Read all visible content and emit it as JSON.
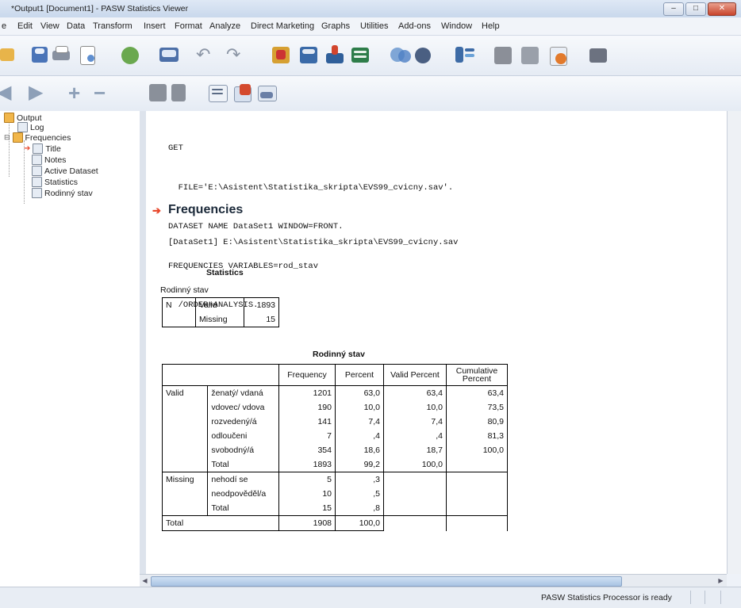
{
  "window": {
    "title": "*Output1 [Document1] - PASW Statistics Viewer"
  },
  "menu": [
    "e",
    "Edit",
    "View",
    "Data",
    "Transform",
    "Insert",
    "Format",
    "Analyze",
    "Direct Marketing",
    "Graphs",
    "Utilities",
    "Add-ons",
    "Window",
    "Help"
  ],
  "nav": {
    "output": "Output",
    "log": "Log",
    "frequencies": "Frequencies",
    "title": "Title",
    "notes": "Notes",
    "active_dataset": "Active Dataset",
    "statistics": "Statistics",
    "rodinny_stav": "Rodinný stav"
  },
  "syntax": [
    "GET",
    "  FILE='E:\\Asistent\\Statistika_skripta\\EVS99_cvicny.sav'.",
    "DATASET NAME DataSet1 WINDOW=FRONT.",
    "FREQUENCIES VARIABLES=rod_stav",
    "  /ORDER=ANALYSIS."
  ],
  "frequencies_title": "Frequencies",
  "dataset_line": "[DataSet1] E:\\Asistent\\Statistika_skripta\\EVS99_cvicny.sav",
  "statistics": {
    "caption": "Statistics",
    "variable": "Rodinný stav",
    "n": "N",
    "valid_label": "Valid",
    "valid_value": "1893",
    "missing_label": "Missing",
    "missing_value": "15"
  },
  "freq_table": {
    "caption": "Rodinný stav",
    "headers": {
      "frequency": "Frequency",
      "percent": "Percent",
      "valid_percent": "Valid Percent",
      "cumulative_1": "Cumulative",
      "cumulative_2": "Percent"
    },
    "valid_group": "Valid",
    "missing_group": "Missing",
    "total_group": "Total",
    "valid_rows": [
      {
        "label": "ženatý/ vdaná",
        "freq": "1201",
        "pct": "63,0",
        "vpct": "63,4",
        "cpct": "63,4"
      },
      {
        "label": "vdovec/ vdova",
        "freq": "190",
        "pct": "10,0",
        "vpct": "10,0",
        "cpct": "73,5"
      },
      {
        "label": "rozvedený/á",
        "freq": "141",
        "pct": "7,4",
        "vpct": "7,4",
        "cpct": "80,9"
      },
      {
        "label": "odloučeni",
        "freq": "7",
        "pct": ",4",
        "vpct": ",4",
        "cpct": "81,3"
      },
      {
        "label": "svobodný/á",
        "freq": "354",
        "pct": "18,6",
        "vpct": "18,7",
        "cpct": "100,0"
      },
      {
        "label": "Total",
        "freq": "1893",
        "pct": "99,2",
        "vpct": "100,0",
        "cpct": ""
      }
    ],
    "missing_rows": [
      {
        "label": "nehodí se",
        "freq": "5",
        "pct": ",3"
      },
      {
        "label": "neodpověděl/a",
        "freq": "10",
        "pct": ",5"
      },
      {
        "label": "Total",
        "freq": "15",
        "pct": ",8"
      }
    ],
    "total_row": {
      "freq": "1908",
      "pct": "100,0"
    }
  },
  "status": {
    "message": "PASW Statistics Processor is ready"
  }
}
